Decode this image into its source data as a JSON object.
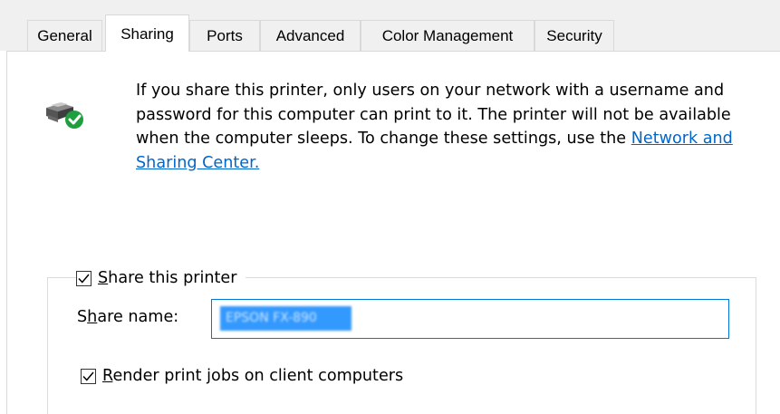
{
  "tabs": [
    {
      "label": "General",
      "active": false
    },
    {
      "label": "Sharing",
      "active": true
    },
    {
      "label": "Ports",
      "active": false
    },
    {
      "label": "Advanced",
      "active": false
    },
    {
      "label": "Color Management",
      "active": false
    },
    {
      "label": "Security",
      "active": false
    }
  ],
  "info": {
    "text": "If you share this printer, only users on your network with a username and password for this computer can print to it. The printer will not be available when the computer sleeps. To change these settings, use the ",
    "link": "Network and Sharing Center."
  },
  "share_printer": {
    "label_accel": "S",
    "label_rest": "hare this printer",
    "checked": true
  },
  "share_name": {
    "label_pre": "S",
    "label_accel": "h",
    "label_rest": "are name:",
    "value": "EPSON FX-890"
  },
  "render_jobs": {
    "label_accel": "R",
    "label_rest": "ender print jobs on client computers",
    "checked": true
  },
  "icons": {
    "printer": "shared-printer-icon",
    "check": "checkmark-icon"
  },
  "colors": {
    "link": "#0066cc",
    "focus_border": "#0078d7",
    "selection": "#3399ff",
    "badge": "#1e9e3e"
  }
}
